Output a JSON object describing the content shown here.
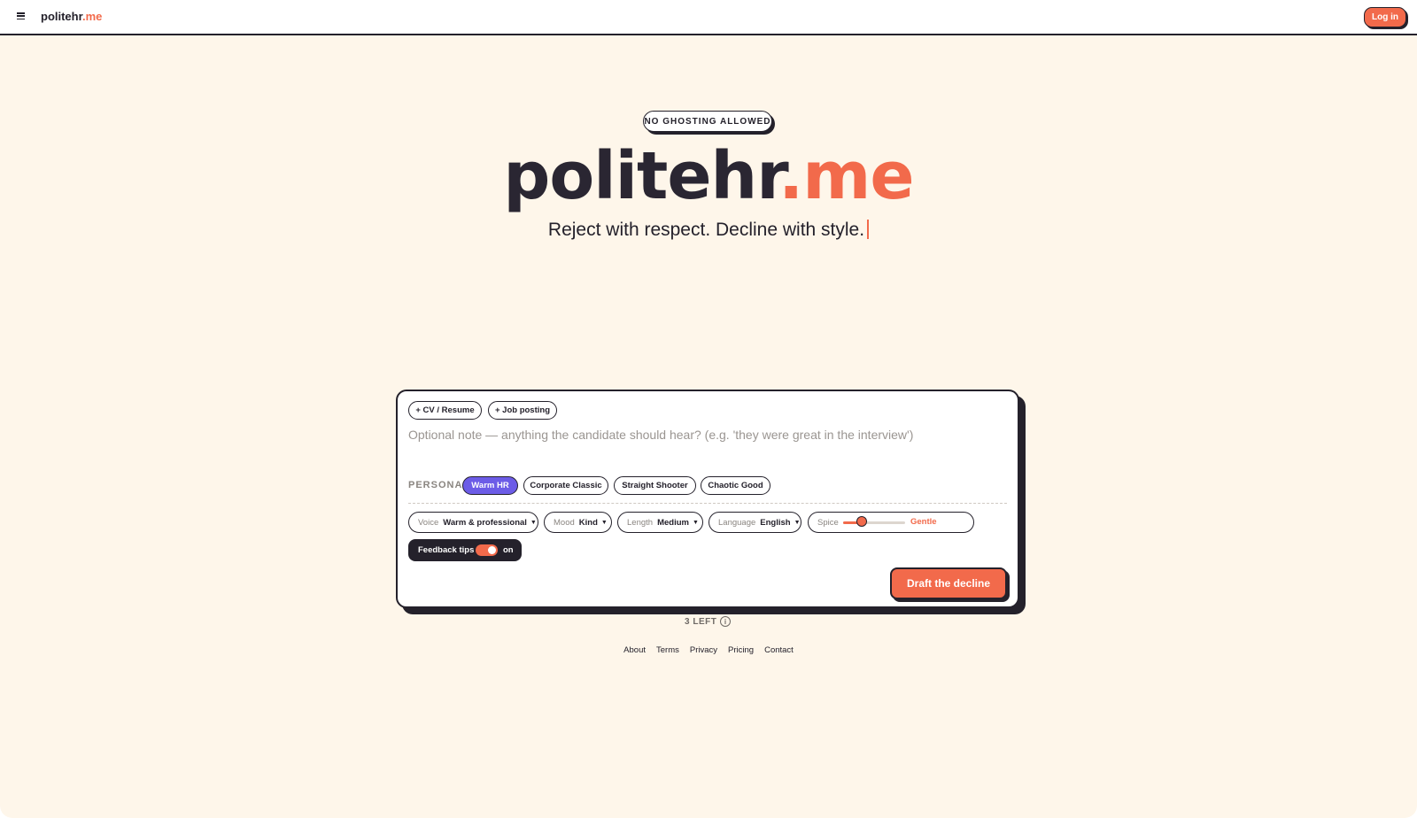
{
  "header": {
    "brand": "politehr",
    "brand_suffix": ".me",
    "login_label": "Log in",
    "menu_icon": "menu-icon"
  },
  "hero": {
    "badge": "NO GHOSTING ALLOWED",
    "title": "politehr",
    "title_suffix": ".me",
    "tagline": "Reject with respect. Decline with style."
  },
  "composer": {
    "attach_cv": "+ CV / Resume",
    "attach_job": "+ Job posting",
    "note_placeholder": "Optional note — anything the candidate should hear? (e.g. 'they were great in the interview')",
    "persona_label": "PERSONA",
    "personas": [
      "Warm HR",
      "Corporate Classic",
      "Straight Shooter",
      "Chaotic Good"
    ],
    "active_persona": "Warm HR",
    "voice": {
      "label": "Voice",
      "value": "Warm & professional"
    },
    "mood": {
      "label": "Mood",
      "value": "Kind"
    },
    "length": {
      "label": "Length",
      "value": "Medium"
    },
    "language": {
      "label": "Language",
      "value": "English"
    },
    "spice": {
      "label": "Spice",
      "value": "Gentle",
      "level": 0.3
    },
    "feedback": {
      "label": "Feedback tips",
      "state": "on"
    },
    "submit_label": "Draft the decline"
  },
  "quota": {
    "text": "3 LEFT"
  },
  "footer": {
    "links": [
      "About",
      "Terms",
      "Privacy",
      "Pricing",
      "Contact"
    ]
  },
  "colors": {
    "accent": "#f26a4b",
    "persona_active": "#6c5ce7",
    "ink": "#24212b",
    "background": "#fef6ea"
  }
}
